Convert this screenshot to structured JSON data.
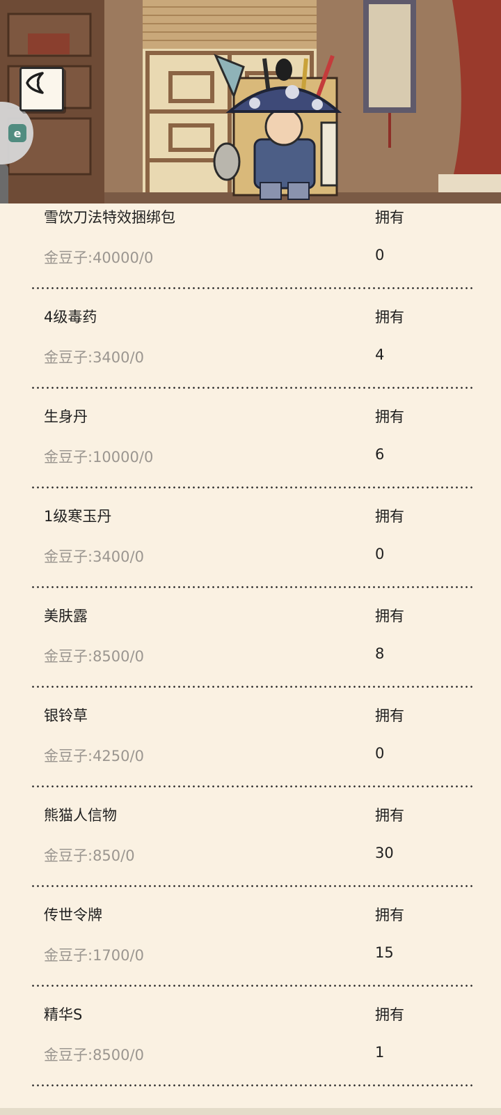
{
  "items": [
    {
      "name": "雪饮刀法特效捆绑包",
      "owned_label": "拥有",
      "price": "金豆子:40000/0",
      "owned_count": "0"
    },
    {
      "name": "4级毒药",
      "owned_label": "拥有",
      "price": "金豆子:3400/0",
      "owned_count": "4"
    },
    {
      "name": "生身丹",
      "owned_label": "拥有",
      "price": "金豆子:10000/0",
      "owned_count": "6"
    },
    {
      "name": "1级寒玉丹",
      "owned_label": "拥有",
      "price": "金豆子:3400/0",
      "owned_count": "0"
    },
    {
      "name": "美肤露",
      "owned_label": "拥有",
      "price": "金豆子:8500/0",
      "owned_count": "8"
    },
    {
      "name": "银铃草",
      "owned_label": "拥有",
      "price": "金豆子:4250/0",
      "owned_count": "0"
    },
    {
      "name": "熊猫人信物",
      "owned_label": "拥有",
      "price": "金豆子:850/0",
      "owned_count": "30"
    },
    {
      "name": "传世令牌",
      "owned_label": "拥有",
      "price": "金豆子:1700/0",
      "owned_count": "15"
    },
    {
      "name": "精华S",
      "owned_label": "拥有",
      "price": "金豆子:8500/0",
      "owned_count": "1"
    }
  ],
  "icons": {
    "back": "chevron-left-icon",
    "side_tab": "app-shortcut-icon",
    "side_tab_glyph": "e"
  }
}
